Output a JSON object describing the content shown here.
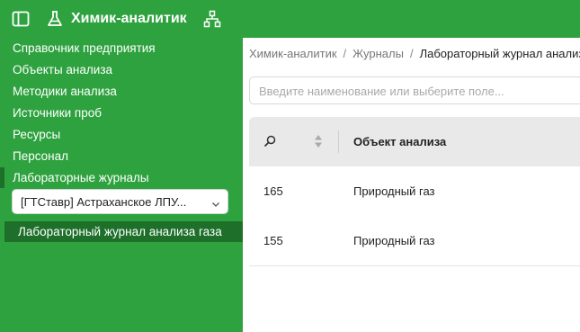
{
  "app": {
    "title": "Химик-аналитик"
  },
  "sidebar": {
    "items": [
      {
        "label": "Справочник предприятия"
      },
      {
        "label": "Объекты анализа"
      },
      {
        "label": "Методики анализа"
      },
      {
        "label": "Источники проб"
      },
      {
        "label": "Ресурсы"
      },
      {
        "label": "Персонал"
      },
      {
        "label": "Лабораторные журналы"
      }
    ],
    "journal_select": {
      "value": "[ГТСтавр] Астраханское ЛПУ..."
    },
    "sub_items": [
      {
        "label": "Лабораторный журнал анализа газа"
      }
    ]
  },
  "breadcrumb": {
    "items": [
      {
        "label": "Химик-аналитик"
      },
      {
        "label": "Журналы"
      },
      {
        "label": "Лабораторный журнал анализа газа"
      }
    ],
    "separator": "/"
  },
  "search": {
    "placeholder": "Введите наименование или выберите поле..."
  },
  "table": {
    "columns": [
      {
        "label": "Объект анализа"
      }
    ],
    "rows": [
      {
        "id": "165",
        "object": "Природный газ"
      },
      {
        "id": "155",
        "object": "Природный газ"
      }
    ]
  },
  "colors": {
    "brand_green": "#2ea23f",
    "active_green": "#1d6f2a"
  },
  "icons": {
    "sidebar_toggle": "sidebar-toggle-icon",
    "flask": "flask-icon",
    "hierarchy": "hierarchy-icon",
    "search": "search-icon",
    "sort": "sort-icon",
    "chevron": "chevron-down-icon"
  }
}
